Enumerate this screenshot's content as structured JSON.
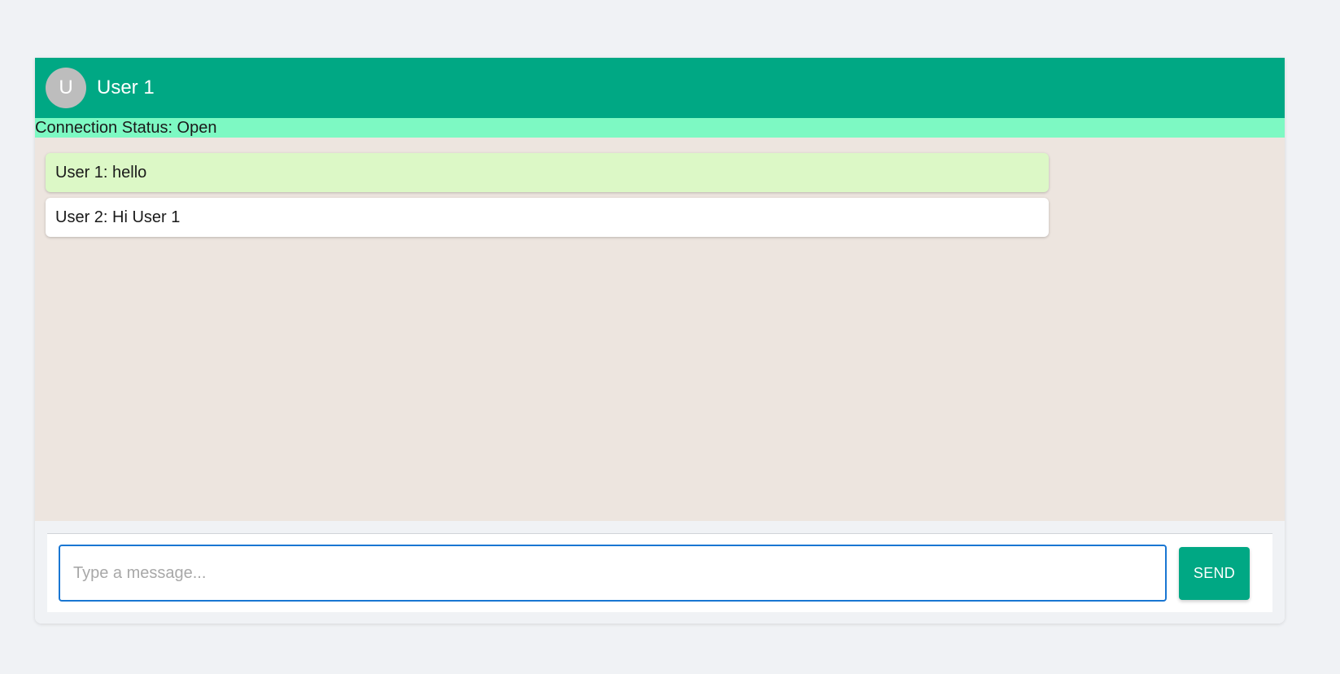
{
  "colors": {
    "header": "#00a884",
    "status_bar": "#7df9c3",
    "chat_background": "#ede5df",
    "own_message": "#dcf8c6",
    "other_message": "#ffffff",
    "input_border": "#1976d2",
    "send_button": "#00a884"
  },
  "header": {
    "avatar_letter": "U",
    "title": "User 1"
  },
  "status": {
    "text": "Connection Status: Open"
  },
  "messages": [
    {
      "text": "User 1: hello",
      "own": true
    },
    {
      "text": "User 2: Hi User 1",
      "own": false
    }
  ],
  "composer": {
    "placeholder": "Type a message...",
    "value": "",
    "send_label": "SEND"
  }
}
